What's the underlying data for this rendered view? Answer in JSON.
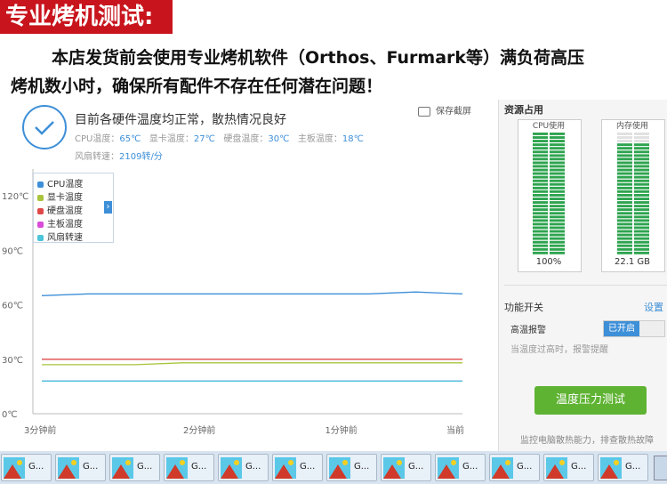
{
  "banner": {
    "title": "专业烤机测试:"
  },
  "promo": {
    "line1": "本店发货前会使用专业烤机软件（Orthos、Furmark等）满负荷高压",
    "line2": "烤机数小时，确保所有配件不存在任何潜在问题！"
  },
  "status": {
    "title": "目前各硬件温度均正常，散热情况良好",
    "cpu_label": "CPU温度：",
    "cpu_value": "65℃",
    "gpu_label": "显卡温度：",
    "gpu_value": "27℃",
    "disk_label": "硬盘温度：",
    "disk_value": "30℃",
    "board_label": "主板温度：",
    "board_value": "18℃",
    "fan_label": "风扇转速：",
    "fan_value": "2109转/分",
    "screenshot_label": "保存截屏"
  },
  "chart_data": {
    "type": "line",
    "x_ticks": [
      "3分钟前",
      "2分钟前",
      "1分钟前",
      "当前"
    ],
    "y_ticks": [
      "120℃",
      "90℃",
      "60℃",
      "30℃",
      "0℃"
    ],
    "ylim": [
      0,
      120
    ],
    "legend": [
      {
        "name": "CPU温度",
        "color": "#3d8fd8"
      },
      {
        "name": "显卡温度",
        "color": "#a8c43c"
      },
      {
        "name": "硬盘温度",
        "color": "#e04848"
      },
      {
        "name": "主板温度",
        "color": "#d94cd9"
      },
      {
        "name": "风扇转速",
        "color": "#4cc4d9"
      }
    ],
    "series": [
      {
        "name": "CPU温度",
        "color": "#3d8fd8",
        "values": [
          65,
          66,
          66,
          66,
          66,
          66,
          66,
          66,
          67,
          66
        ]
      },
      {
        "name": "显卡温度",
        "color": "#a8c43c",
        "values": [
          27,
          27,
          27,
          28,
          28,
          28,
          28,
          28,
          28,
          28
        ]
      },
      {
        "name": "硬盘温度",
        "color": "#e04848",
        "values": [
          30,
          30,
          30,
          30,
          30,
          30,
          30,
          30,
          30,
          30
        ]
      },
      {
        "name": "主板温度",
        "color": "#d94cd9",
        "values": [
          18,
          18,
          18,
          18,
          18,
          18,
          18,
          18,
          18,
          18
        ]
      },
      {
        "name": "风扇转速",
        "color": "#4cc4d9",
        "values": [
          18,
          18,
          18,
          18,
          18,
          18,
          18,
          18,
          18,
          18
        ]
      }
    ]
  },
  "right_panel": {
    "resources_title": "资源占用",
    "cpu_meter_title": "CPU使用",
    "cpu_meter_value": "100%",
    "cpu_fraction": 1.0,
    "mem_meter_title": "内存使用",
    "mem_meter_value": "22.1 GB",
    "mem_fraction": 0.92,
    "function_title": "功能开关",
    "settings_label": "设置",
    "alarm_label": "高温报警",
    "toggle_label": "已开启",
    "alarm_desc": "当温度过高时，报警提醒",
    "stress_button": "温度压力测试",
    "stress_note": "监控电脑散热能力，排查散热故障"
  },
  "taskbar": {
    "items": [
      "G...",
      "G...",
      "G...",
      "G...",
      "G...",
      "G...",
      "G...",
      "G...",
      "G...",
      "G...",
      "G...",
      "G..."
    ]
  },
  "colors": {
    "accent": "#3d8fd8",
    "banner": "#c8141c",
    "meter": "#2ea44f",
    "button": "#5fb333"
  }
}
